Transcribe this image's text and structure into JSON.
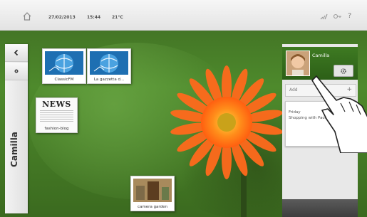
{
  "topbar": {
    "date": "27/02/2013",
    "time": "15:44",
    "temperature": "21°C",
    "help": "?"
  },
  "left_panel": {
    "user_label": "Camilla"
  },
  "tiles": [
    {
      "caption": "ClassicFM"
    },
    {
      "caption": "La gazzetta d..."
    },
    {
      "caption": "fashion-blog",
      "header": "NEWS"
    },
    {
      "caption": "camera garden"
    }
  ],
  "right_panel": {
    "profile_name": "Camilla",
    "add_label": "Add",
    "add_symbol": "+",
    "note_line1": "Friday",
    "note_line2": "Shopping with Paola"
  },
  "colors": {
    "profile_green": "#3e7a22",
    "topbar": "#eeeeee"
  }
}
